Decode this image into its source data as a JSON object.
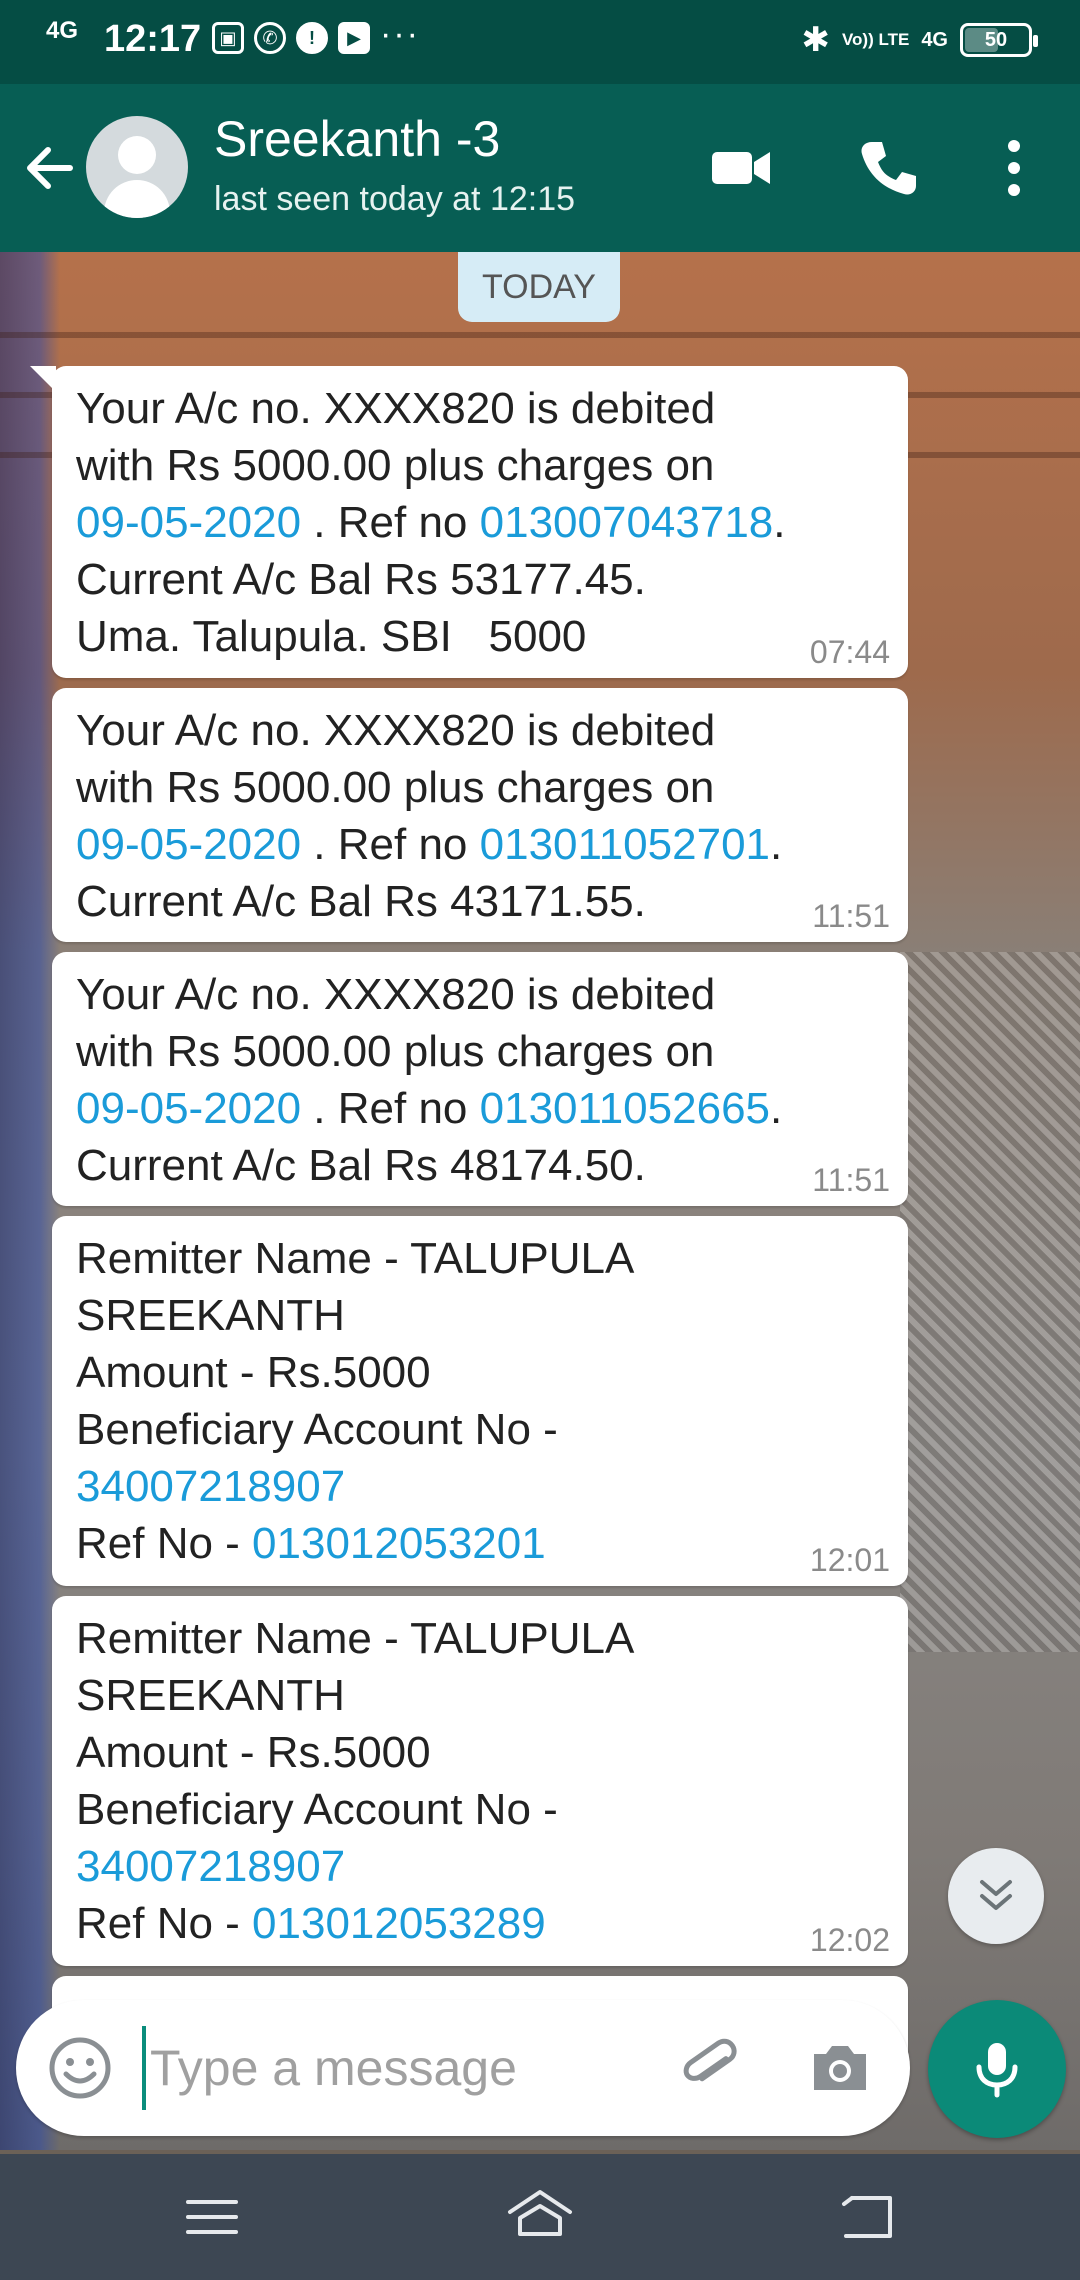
{
  "status_bar": {
    "network": "4G",
    "time": "12:17",
    "volte": "Vo)) LTE",
    "network_right": "4G",
    "battery": "50"
  },
  "header": {
    "contact_name": "Sreekanth -3",
    "last_seen": "last seen today at 12:15",
    "icons": [
      "back-arrow-icon",
      "avatar",
      "video-call-icon",
      "voice-call-icon",
      "more-options-icon"
    ]
  },
  "date_chip": "TODAY",
  "messages": [
    {
      "l1": "Your A/c no. XXXX820 is debited",
      "l2": "with Rs 5000.00 plus charges on",
      "date": "09-05-2020",
      "ref_prefix": " . Ref no ",
      "ref": "013007043718",
      "ref_suffix": ".",
      "l4": "Current A/c Bal Rs 53177.45.",
      "l5": "Uma. Talupula. SBI   5000",
      "time": "07:44"
    },
    {
      "l1": "Your A/c no. XXXX820 is debited",
      "l2": "with Rs 5000.00 plus charges on",
      "date": "09-05-2020",
      "ref_prefix": " . Ref no ",
      "ref": "013011052701",
      "ref_suffix": ".",
      "l4": "Current A/c Bal Rs 43171.55.",
      "time": "11:51"
    },
    {
      "l1": "Your A/c no. XXXX820 is debited",
      "l2": "with Rs 5000.00 plus charges on",
      "date": "09-05-2020",
      "ref_prefix": " . Ref no ",
      "ref": "013011052665",
      "ref_suffix": ".",
      "l4": "Current A/c Bal Rs 48174.50.",
      "time": "11:51"
    },
    {
      "l1": "Remitter Name - TALUPULA",
      "l2": "SREEKANTH",
      "l3": "Amount - Rs.5000",
      "l4": "Beneficiary Account No -",
      "account": "34007218907",
      "ref_label": "Ref No - ",
      "ref": "013012053201",
      "time": "12:01"
    },
    {
      "l1": "Remitter Name - TALUPULA",
      "l2": "SREEKANTH",
      "l3": "Amount - Rs.5000",
      "l4": "Beneficiary Account No -",
      "account": "34007218907",
      "ref_label": "Ref No - ",
      "ref": "013012053289",
      "time": "12:02"
    }
  ],
  "input": {
    "placeholder": "Type a message"
  },
  "colors": {
    "header_bg": "#075e54",
    "status_bg": "#054d44",
    "link": "#1a9bd9",
    "mic_button": "#0b8a78",
    "nav_bg": "#3d4753"
  }
}
